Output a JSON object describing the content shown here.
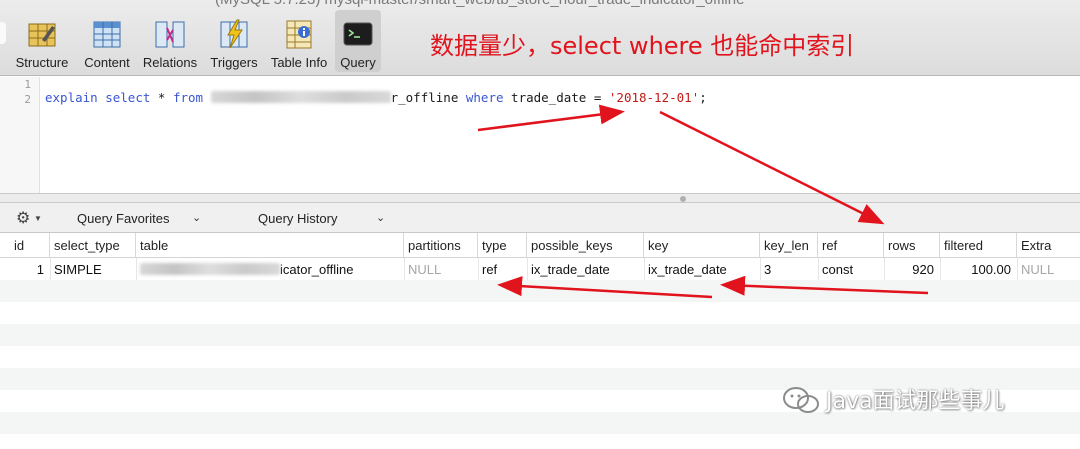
{
  "window": {
    "title": "(MySQL 5.7.23) mysql-master/smart_web/tb_store_hour_trade_indicator_offline"
  },
  "toolbar": {
    "items": [
      {
        "label": "Structure"
      },
      {
        "label": "Content"
      },
      {
        "label": "Relations"
      },
      {
        "label": "Triggers"
      },
      {
        "label": "Table Info"
      },
      {
        "label": "Query"
      }
    ]
  },
  "annotation": {
    "text": "数据量少，select where 也能命中索引"
  },
  "editor": {
    "line_numbers": [
      "1",
      "2"
    ],
    "kw_explain": "explain",
    "kw_select": "select",
    "star": "*",
    "kw_from": "from",
    "table_suffix": "r_offline",
    "kw_where": "where",
    "column": "trade_date",
    "eq": "=",
    "value": "'2018-12-01'",
    "semicolon": ";"
  },
  "query_bar": {
    "favorites": "Query Favorites",
    "history": "Query History"
  },
  "results": {
    "columns": [
      "id",
      "select_type",
      "table",
      "partitions",
      "type",
      "possible_keys",
      "key",
      "key_len",
      "ref",
      "rows",
      "filtered",
      "Extra"
    ],
    "row": {
      "id": "1",
      "select_type": "SIMPLE",
      "table_suffix": "icator_offline",
      "partitions": "NULL",
      "type": "ref",
      "possible_keys": "ix_trade_date",
      "key": "ix_trade_date",
      "key_len": "3",
      "ref": "const",
      "rows": "920",
      "filtered": "100.00",
      "extra": "NULL"
    }
  },
  "watermark": {
    "text": "Java面试那些事儿"
  },
  "colors": {
    "annotation": "#e1131c",
    "keyword": "#3a56d4",
    "string": "#c41a16",
    "null": "#a6a6a6"
  }
}
